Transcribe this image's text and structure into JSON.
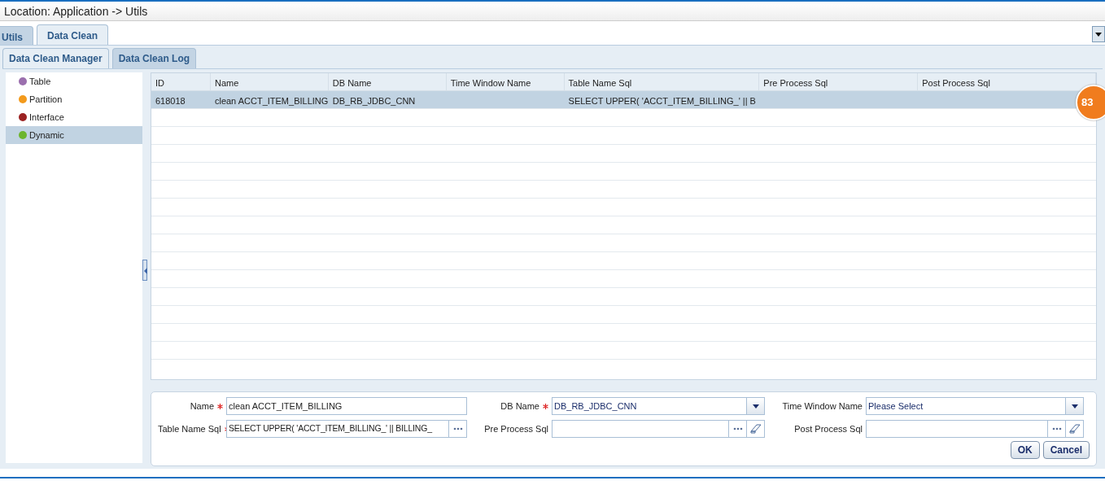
{
  "location": "Location: Application -> Utils",
  "main_tabs": [
    {
      "label": "Utils",
      "selected": false
    },
    {
      "label": "Data Clean",
      "selected": true
    }
  ],
  "sub_tabs": [
    {
      "label": "Data Clean Manager",
      "selected": true
    },
    {
      "label": "Data Clean Log",
      "selected": false
    }
  ],
  "categories": [
    {
      "label": "Table",
      "color": "#9b6fae",
      "selected": false
    },
    {
      "label": "Partition",
      "color": "#f39a1c",
      "selected": false
    },
    {
      "label": "Interface",
      "color": "#9b2222",
      "selected": false
    },
    {
      "label": "Dynamic",
      "color": "#6cb52d",
      "selected": true
    }
  ],
  "table": {
    "columns": [
      "ID",
      "Name",
      "DB Name",
      "Time Window Name",
      "Table Name Sql",
      "Pre Process Sql",
      "Post Process Sql"
    ],
    "rows": [
      {
        "selected": true,
        "cells": [
          "618018",
          "clean ACCT_ITEM_BILLING",
          "DB_RB_JDBC_CNN",
          "",
          "SELECT UPPER( 'ACCT_ITEM_BILLING_' || B",
          "",
          ""
        ]
      }
    ]
  },
  "notification_badge": "83",
  "form": {
    "fields": [
      {
        "label": "Name",
        "required": true,
        "kind": "text",
        "value": "clean ACCT_ITEM_BILLING"
      },
      {
        "label": "DB Name",
        "required": true,
        "kind": "select",
        "value": "DB_RB_JDBC_CNN"
      },
      {
        "label": "Time Window Name",
        "required": false,
        "kind": "select",
        "value": "Please Select"
      },
      {
        "label": "Table Name Sql",
        "required": true,
        "kind": "lookup",
        "value": "SELECT UPPER( 'ACCT_ITEM_BILLING_' || BILLING_"
      },
      {
        "label": "Pre Process Sql",
        "required": false,
        "kind": "lookup-clear"
      },
      {
        "label": "Post Process Sql",
        "required": false,
        "kind": "lookup-clear"
      }
    ],
    "buttons": [
      "OK",
      "Cancel"
    ]
  }
}
